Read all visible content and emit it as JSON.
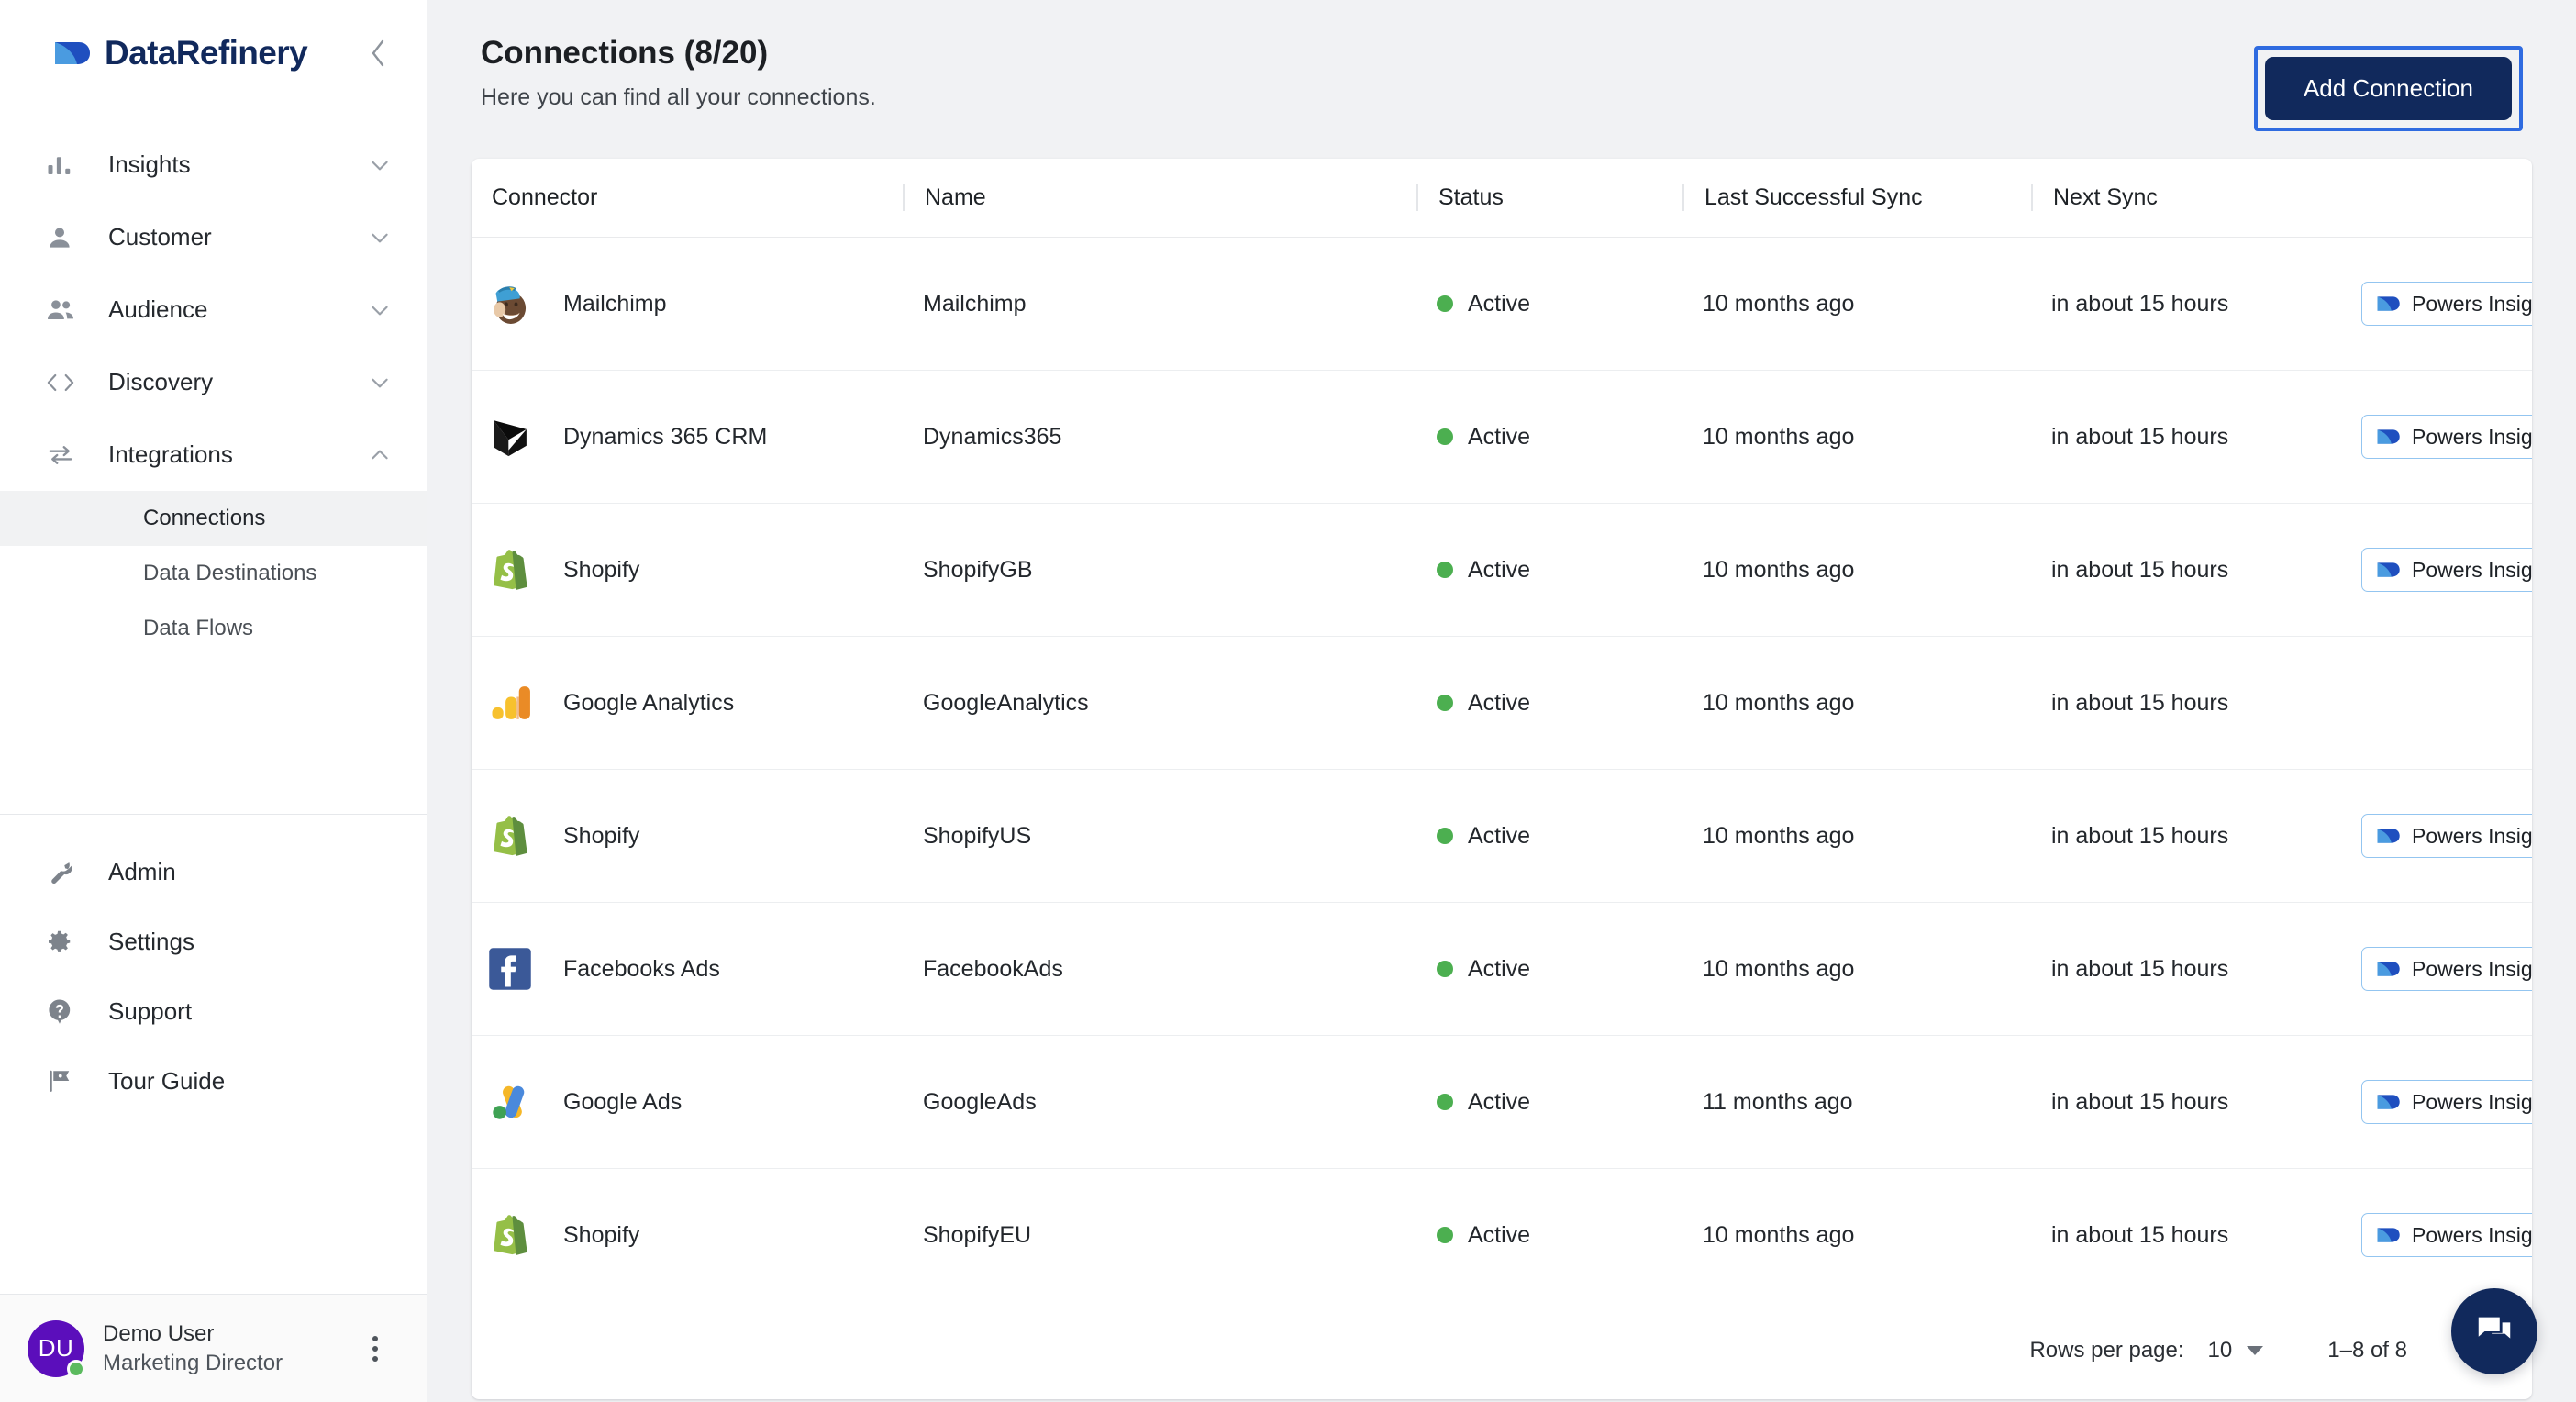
{
  "app": {
    "brand_name": "DataRefinery",
    "collapse_icon": "chevron-left-icon"
  },
  "sidebar": {
    "nav": [
      {
        "label": "Insights",
        "icon": "bar-chart-icon",
        "chevron": "chevron-down-icon"
      },
      {
        "label": "Customer",
        "icon": "person-icon",
        "chevron": "chevron-down-icon"
      },
      {
        "label": "Audience",
        "icon": "people-icon",
        "chevron": "chevron-down-icon"
      },
      {
        "label": "Discovery",
        "icon": "code-brackets-icon",
        "chevron": "chevron-down-icon"
      },
      {
        "label": "Integrations",
        "icon": "sync-arrows-icon",
        "chevron": "chevron-up-icon"
      }
    ],
    "sub_items": [
      {
        "label": "Connections",
        "active": true
      },
      {
        "label": "Data Destinations",
        "active": false
      },
      {
        "label": "Data Flows",
        "active": false
      }
    ],
    "bottom_nav": [
      {
        "label": "Admin",
        "icon": "wrench-icon"
      },
      {
        "label": "Settings",
        "icon": "gear-icon"
      },
      {
        "label": "Support",
        "icon": "help-circle-icon"
      },
      {
        "label": "Tour Guide",
        "icon": "flag-icon"
      }
    ],
    "user": {
      "initials": "DU",
      "name": "Demo User",
      "role": "Marketing Director",
      "presence": "online",
      "menu_icon": "kebab-menu-icon"
    }
  },
  "header": {
    "title": "Connections (8/20)",
    "subtitle": "Here you can find all your connections.",
    "add_button": "Add Connection"
  },
  "table": {
    "columns": [
      "Connector",
      "Name",
      "Status",
      "Last Successful Sync",
      "Next Sync",
      ""
    ],
    "rows": [
      {
        "logo": "mailchimp-logo",
        "connector": "Mailchimp",
        "name": "Mailchimp",
        "status": "Active",
        "last_sync": "10 months ago",
        "next_sync": "in about 15 hours",
        "badge": "Powers Insights"
      },
      {
        "logo": "dynamics365-logo",
        "connector": "Dynamics 365 CRM",
        "name": "Dynamics365",
        "status": "Active",
        "last_sync": "10 months ago",
        "next_sync": "in about 15 hours",
        "badge": "Powers Insights"
      },
      {
        "logo": "shopify-logo",
        "connector": "Shopify",
        "name": "ShopifyGB",
        "status": "Active",
        "last_sync": "10 months ago",
        "next_sync": "in about 15 hours",
        "badge": "Powers Insights"
      },
      {
        "logo": "google-analytics-logo",
        "connector": "Google Analytics",
        "name": "GoogleAnalytics",
        "status": "Active",
        "last_sync": "10 months ago",
        "next_sync": "in about 15 hours",
        "badge": ""
      },
      {
        "logo": "shopify-logo",
        "connector": "Shopify",
        "name": "ShopifyUS",
        "status": "Active",
        "last_sync": "10 months ago",
        "next_sync": "in about 15 hours",
        "badge": "Powers Insights"
      },
      {
        "logo": "facebook-logo",
        "connector": "Facebooks Ads",
        "name": "FacebookAds",
        "status": "Active",
        "last_sync": "10 months ago",
        "next_sync": "in about 15 hours",
        "badge": "Powers Insights"
      },
      {
        "logo": "google-ads-logo",
        "connector": "Google Ads",
        "name": "GoogleAds",
        "status": "Active",
        "last_sync": "11 months ago",
        "next_sync": "in about 15 hours",
        "badge": "Powers Insights"
      },
      {
        "logo": "shopify-logo",
        "connector": "Shopify",
        "name": "ShopifyEU",
        "status": "Active",
        "last_sync": "10 months ago",
        "next_sync": "in about 15 hours",
        "badge": "Powers Insights"
      }
    ]
  },
  "pagination": {
    "rows_per_page_label": "Rows per page:",
    "rows_per_page_value": "10",
    "range": "1–8 of 8",
    "prev_icon": "chevron-left-icon"
  },
  "chat": {
    "icon": "chat-bubble-icon"
  },
  "colors": {
    "brand_navy": "#11295c",
    "focus_blue": "#2f6be0",
    "status_green": "#4caf50",
    "avatar_purple": "#5b0ebb",
    "badge_border": "#93c5f0"
  }
}
